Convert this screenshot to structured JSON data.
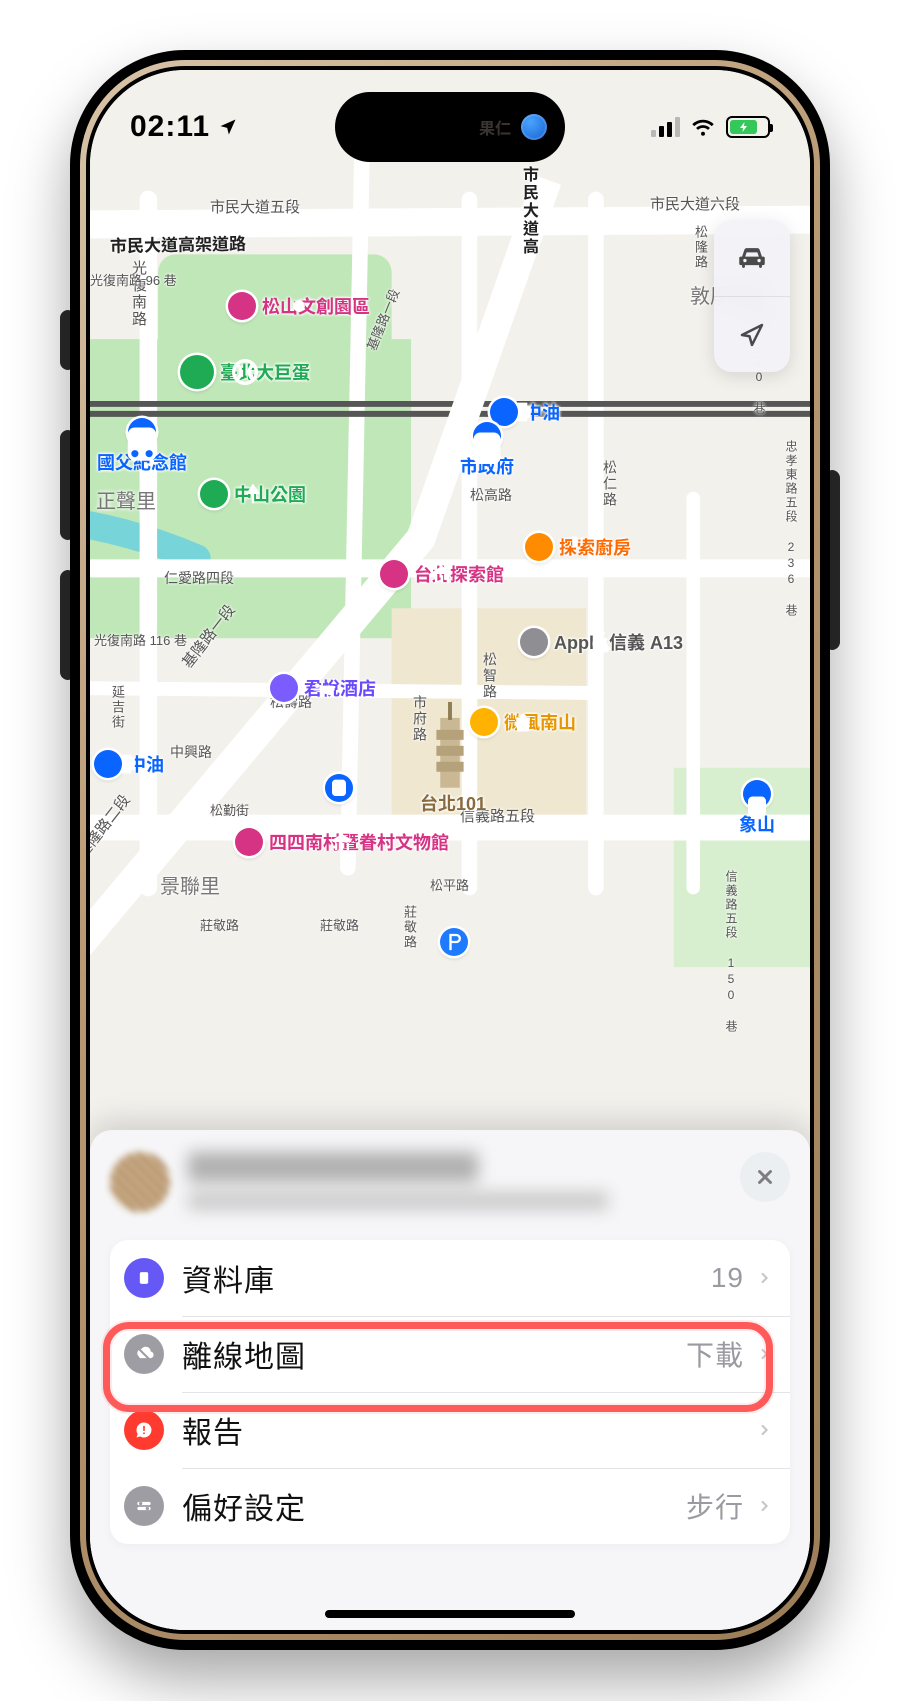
{
  "status": {
    "time": "02:11"
  },
  "island": {
    "label": "果仁"
  },
  "map": {
    "districts": {
      "dunhou": "敦厚里",
      "zhengsheng": "正聲里",
      "jinglian": "景聯里"
    },
    "roads": {
      "shimin_elevated": "市民大道高架道路",
      "shimin5": "市民大道五段",
      "shimin6": "市民大道六段",
      "shimin_hwy": "市民大道高",
      "guangfu_nan": "光復南路",
      "guangfu_96": "光復南路 96 巷",
      "guangfu_116": "光復南路 116 巷",
      "renai": "仁愛路四段",
      "yanji": "延吉街",
      "songgao": "松高路",
      "songren": "松仁路",
      "zhuangjing": "莊敬路",
      "songzhi": "松智路",
      "songshou": "松壽路",
      "shifu": "市府路",
      "xinyi5": "信義路五段",
      "songqin": "松勤街",
      "songping": "松平路",
      "songlong": "松隆路",
      "zhongxing": "中興路",
      "songde120": "松德路 120 巷",
      "xinyi5_150": "信義路五段 150 巷",
      "zhongxiao_e5_236": "忠孝東路五段 236 巷"
    },
    "pois": {
      "songshan": "松山文創園區",
      "arena": "臺北大巨蛋",
      "sunyatsen": "國父紀念館",
      "cpc": "中油",
      "cityhall": "市政府",
      "zhongshanpark": "中山公園",
      "discovery": "台北探索館",
      "discoverykitchen": "探索廚房",
      "apple": "Apple 信義 A13",
      "grandhyatt": "君悅酒店",
      "breeze": "微風南山",
      "taipei101": "台北101",
      "elephant": "象山",
      "sisinan": "四四南村暨眷村文物館",
      "zhongyou": "中油"
    }
  },
  "sheet": {
    "rows": {
      "library": {
        "label": "資料庫",
        "value": "19"
      },
      "offline": {
        "label": "離線地圖",
        "value": "下載"
      },
      "reports": {
        "label": "報告",
        "value": ""
      },
      "prefs": {
        "label": "偏好設定",
        "value": "步行"
      }
    }
  }
}
